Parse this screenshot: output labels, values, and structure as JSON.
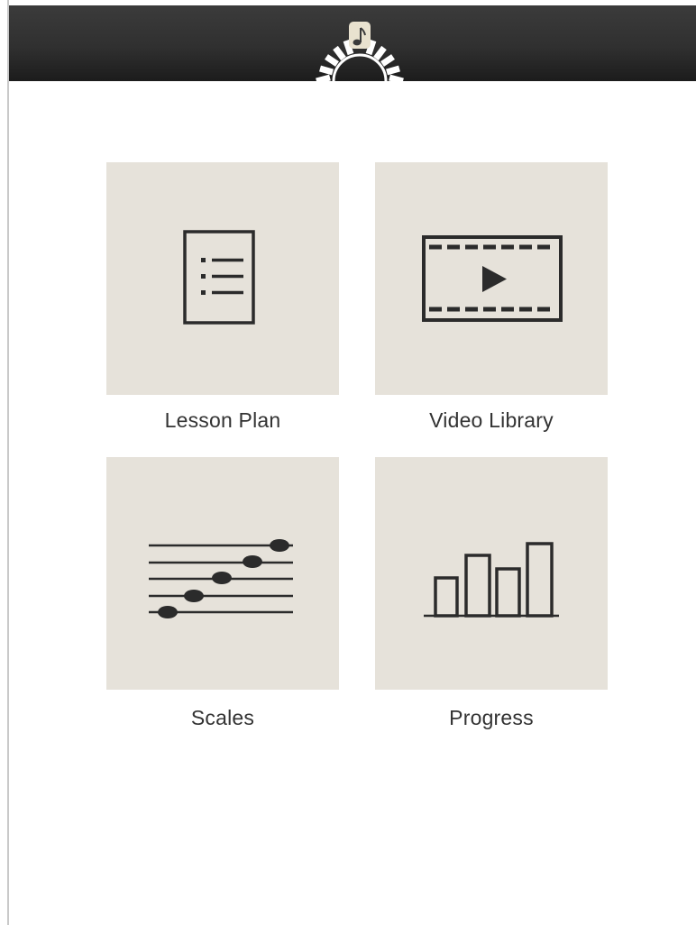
{
  "header": {
    "logo_icon": "piano-keys-music-note-icon",
    "colors": {
      "bar": "#303030",
      "logo": "#ffffff",
      "note_badge": "#e9e2cf"
    }
  },
  "menu": {
    "tile_color": "#e6e2da",
    "icon_color": "#2b2b2b",
    "label_color": "#333333",
    "items": [
      {
        "label": "Lesson Plan",
        "icon": "document-list-icon"
      },
      {
        "label": "Video Library",
        "icon": "video-play-icon"
      },
      {
        "label": "Scales",
        "icon": "music-staff-notes-icon"
      },
      {
        "label": "Progress",
        "icon": "bar-chart-icon"
      }
    ]
  }
}
